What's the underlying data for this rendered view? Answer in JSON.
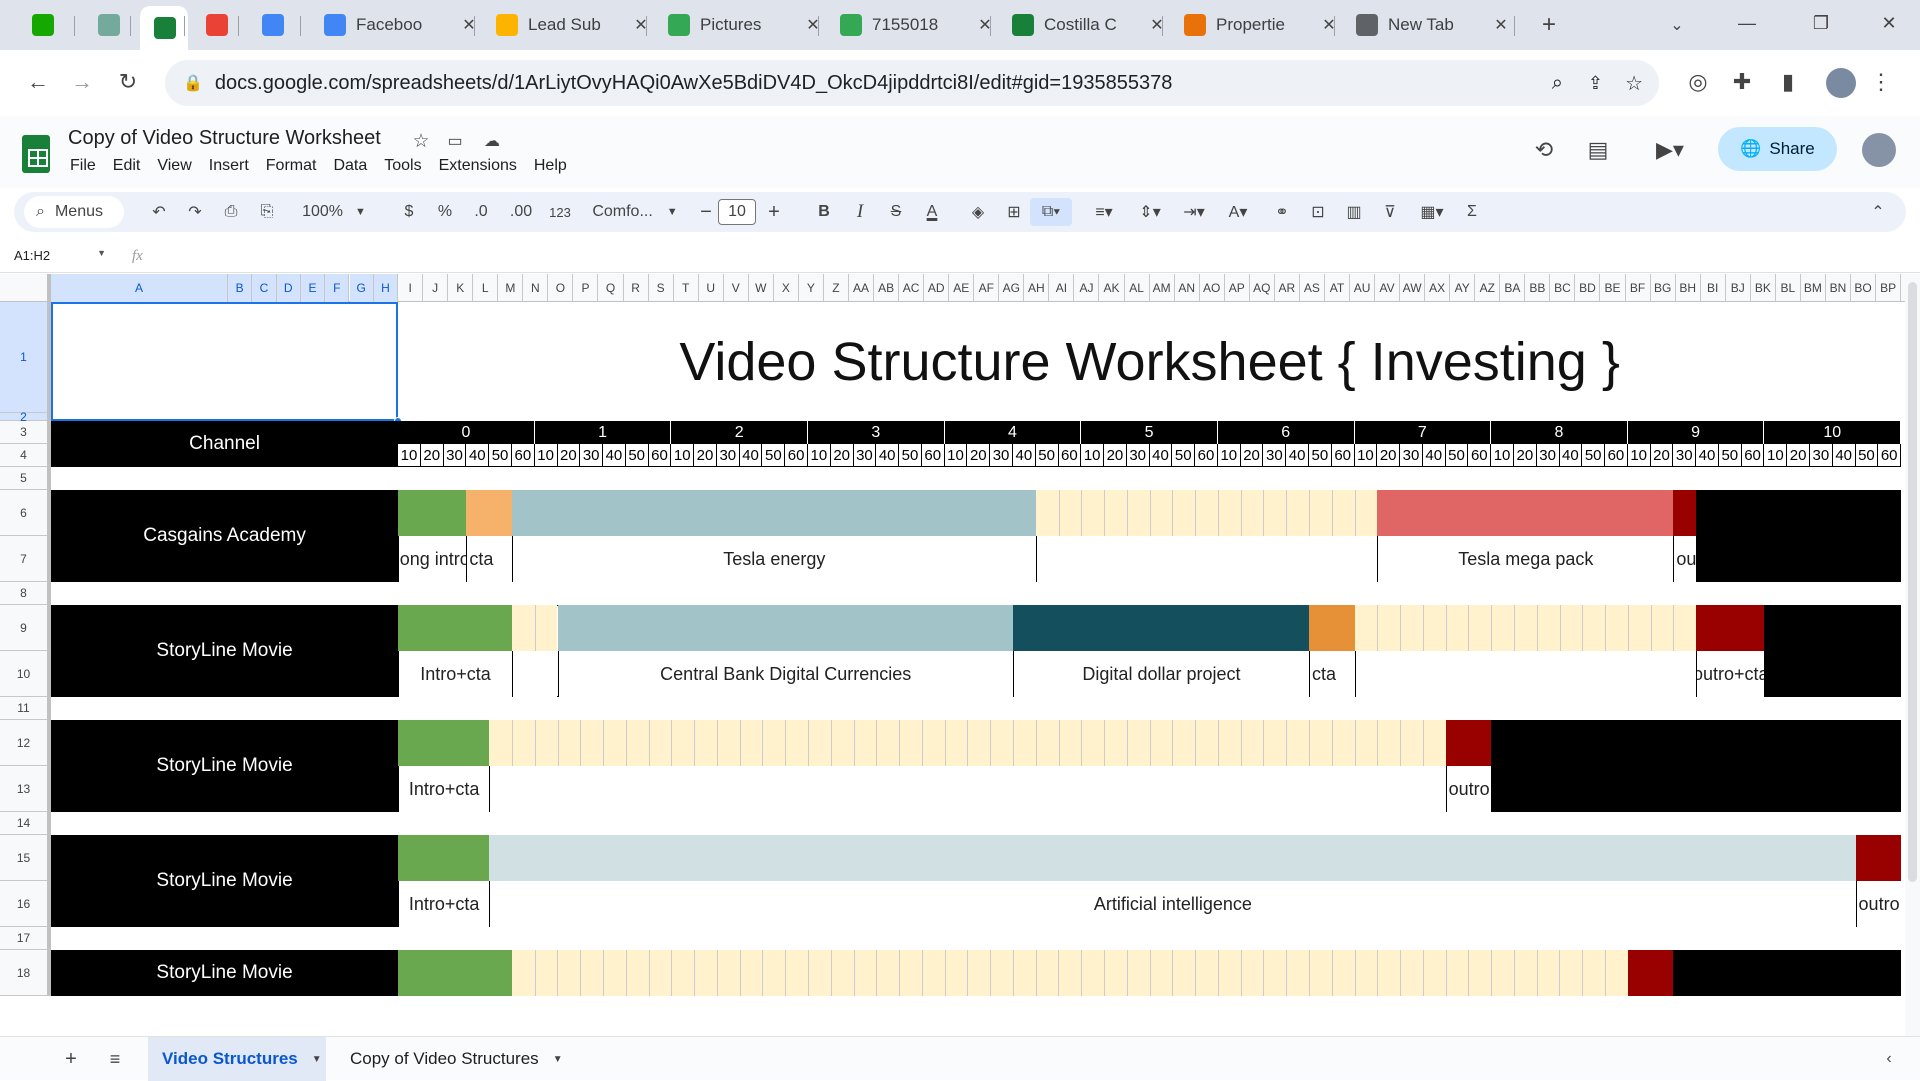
{
  "browser": {
    "tabs": [
      {
        "label": "",
        "icon": "upwork-icon",
        "color": "#14a800"
      },
      {
        "label": "",
        "icon": "chatgpt-icon",
        "color": "#74aa9c"
      },
      {
        "label": "",
        "icon": "sheets-icon",
        "color": "#188038",
        "active": true
      },
      {
        "label": "",
        "icon": "gmail-icon",
        "color": "#ea4335"
      },
      {
        "label": "",
        "icon": "translate-icon",
        "color": "#4285f4"
      },
      {
        "label": "Faceboo",
        "icon": "docs-icon",
        "color": "#4285f4"
      },
      {
        "label": "Lead Sub",
        "icon": "airtable-icon",
        "color": "#fcb400"
      },
      {
        "label": "Pictures",
        "icon": "drive-icon",
        "color": "#34a853"
      },
      {
        "label": "7155018",
        "icon": "drive-icon",
        "color": "#34a853"
      },
      {
        "label": "Costilla C",
        "icon": "sheets-icon",
        "color": "#188038"
      },
      {
        "label": "Propertie",
        "icon": "app-icon",
        "color": "#e8710a"
      },
      {
        "label": "New Tab",
        "icon": "chrome-icon",
        "color": "#5f6368"
      }
    ],
    "url": "docs.google.com/spreadsheets/d/1ArLiytOvyHAQi0AwXe5BdiDV4D_OkcD4jipddrtci8I/edit#gid=1935855378"
  },
  "doc": {
    "title": "Copy of Video Structure Worksheet",
    "menus": [
      "File",
      "Edit",
      "View",
      "Insert",
      "Format",
      "Data",
      "Tools",
      "Extensions",
      "Help"
    ],
    "share_label": "Share"
  },
  "toolbar": {
    "search_label": "Menus",
    "zoom": "100%",
    "currency": "$",
    "percent": "%",
    "dec_less": ".0",
    "dec_more": ".00",
    "number_format": "123",
    "font": "Comfo...",
    "font_size": "10",
    "bold": "B",
    "italic": "I",
    "strike": "S",
    "text_color": "A",
    "sum": "Σ"
  },
  "formula_bar": {
    "name_box": "A1:H2",
    "fx": "fx",
    "content": ""
  },
  "columns": [
    "A",
    "B",
    "C",
    "D",
    "E",
    "F",
    "G",
    "H",
    "I",
    "J",
    "K",
    "L",
    "M",
    "N",
    "O",
    "P",
    "Q",
    "R",
    "S",
    "T",
    "U",
    "V",
    "W",
    "X",
    "Y",
    "Z",
    "AA",
    "AB",
    "AC",
    "AD",
    "AE",
    "AF",
    "AG",
    "AH",
    "AI",
    "AJ",
    "AK",
    "AL",
    "AM",
    "AN",
    "AO",
    "AP",
    "AQ",
    "AR",
    "AS",
    "AT",
    "AU",
    "AV",
    "AW",
    "AX",
    "AY",
    "AZ",
    "BA",
    "BB",
    "BC",
    "BD",
    "BE",
    "BF",
    "BG",
    "BH",
    "BI",
    "BJ",
    "BK",
    "BL",
    "BM",
    "BN",
    "BO",
    "BP"
  ],
  "rows": [
    "1",
    "2",
    "3",
    "4",
    "5",
    "6",
    "7",
    "8",
    "9",
    "10",
    "11",
    "12",
    "13",
    "14",
    "15",
    "16",
    "17",
    "18"
  ],
  "sheet": {
    "title": "Video Structure Worksheet { Investing }",
    "channel_header": "Channel",
    "minutes": [
      "0",
      "1",
      "2",
      "3",
      "4",
      "5",
      "6",
      "7",
      "8",
      "9",
      "10"
    ],
    "seconds": [
      "10",
      "20",
      "30",
      "40",
      "50",
      "60"
    ],
    "colors": {
      "intro": "#6aa84f",
      "cta_orange": "#f6b26b",
      "topic_blue": "#a2c4c9",
      "dark_teal": "#134f5c",
      "cta_dark_orange": "#e69138",
      "empty": "#fff2cc",
      "red": "#e06666",
      "dark_red": "#990000",
      "black": "#000000",
      "ai_gray": "#d0e0e3"
    },
    "channels": [
      {
        "name": "Casgains Academy",
        "segments": [
          {
            "start": 0,
            "len": 3,
            "color": "intro",
            "label": "long intro"
          },
          {
            "start": 3,
            "len": 2,
            "color": "cta_orange",
            "label": "cta"
          },
          {
            "start": 5,
            "len": 23,
            "color": "topic_blue",
            "label": "Tesla energy"
          },
          {
            "start": 28,
            "len": 15,
            "color": "empty",
            "label": ""
          },
          {
            "start": 43,
            "len": 13,
            "color": "red",
            "label": "Tesla mega pack"
          },
          {
            "start": 56,
            "len": 1,
            "color": "dark_red",
            "label": "outro cta"
          },
          {
            "start": 57,
            "len": 9,
            "color": "black",
            "label": ""
          }
        ]
      },
      {
        "name": "StoryLine Movie",
        "segments": [
          {
            "start": 0,
            "len": 5,
            "color": "intro",
            "label": "Intro+cta"
          },
          {
            "start": 5,
            "len": 2,
            "color": "empty",
            "label": ""
          },
          {
            "start": 7,
            "len": 20,
            "color": "topic_blue",
            "label": "Central Bank Digital Currencies"
          },
          {
            "start": 27,
            "len": 13,
            "color": "dark_teal",
            "label": "Digital dollar project"
          },
          {
            "start": 40,
            "len": 2,
            "color": "cta_dark_orange",
            "label": "cta"
          },
          {
            "start": 42,
            "len": 15,
            "color": "empty",
            "label": ""
          },
          {
            "start": 57,
            "len": 3,
            "color": "dark_red",
            "label": "outro+cta"
          },
          {
            "start": 60,
            "len": 6,
            "color": "black",
            "label": ""
          }
        ]
      },
      {
        "name": "StoryLine Movie",
        "segments": [
          {
            "start": 0,
            "len": 4,
            "color": "intro",
            "label": "Intro+cta"
          },
          {
            "start": 4,
            "len": 42,
            "color": "empty",
            "label": ""
          },
          {
            "start": 46,
            "len": 2,
            "color": "dark_red",
            "label": "outro"
          },
          {
            "start": 48,
            "len": 18,
            "color": "black",
            "label": ""
          }
        ]
      },
      {
        "name": "StoryLine Movie",
        "segments": [
          {
            "start": 0,
            "len": 4,
            "color": "intro",
            "label": "Intro+cta"
          },
          {
            "start": 4,
            "len": 60,
            "color": "ai_gray",
            "label": "Artificial intelligence"
          },
          {
            "start": 64,
            "len": 2,
            "color": "dark_red",
            "label": "outro"
          }
        ]
      },
      {
        "name": "StoryLine Movie",
        "segments": [
          {
            "start": 0,
            "len": 5,
            "color": "intro",
            "label": ""
          },
          {
            "start": 5,
            "len": 49,
            "color": "empty",
            "label": ""
          },
          {
            "start": 54,
            "len": 2,
            "color": "dark_red",
            "label": ""
          },
          {
            "start": 56,
            "len": 10,
            "color": "black",
            "label": ""
          }
        ]
      }
    ]
  },
  "sheet_tabs": [
    {
      "label": "Video Structures",
      "active": true
    },
    {
      "label": "Copy of Video Structures",
      "active": false
    }
  ]
}
